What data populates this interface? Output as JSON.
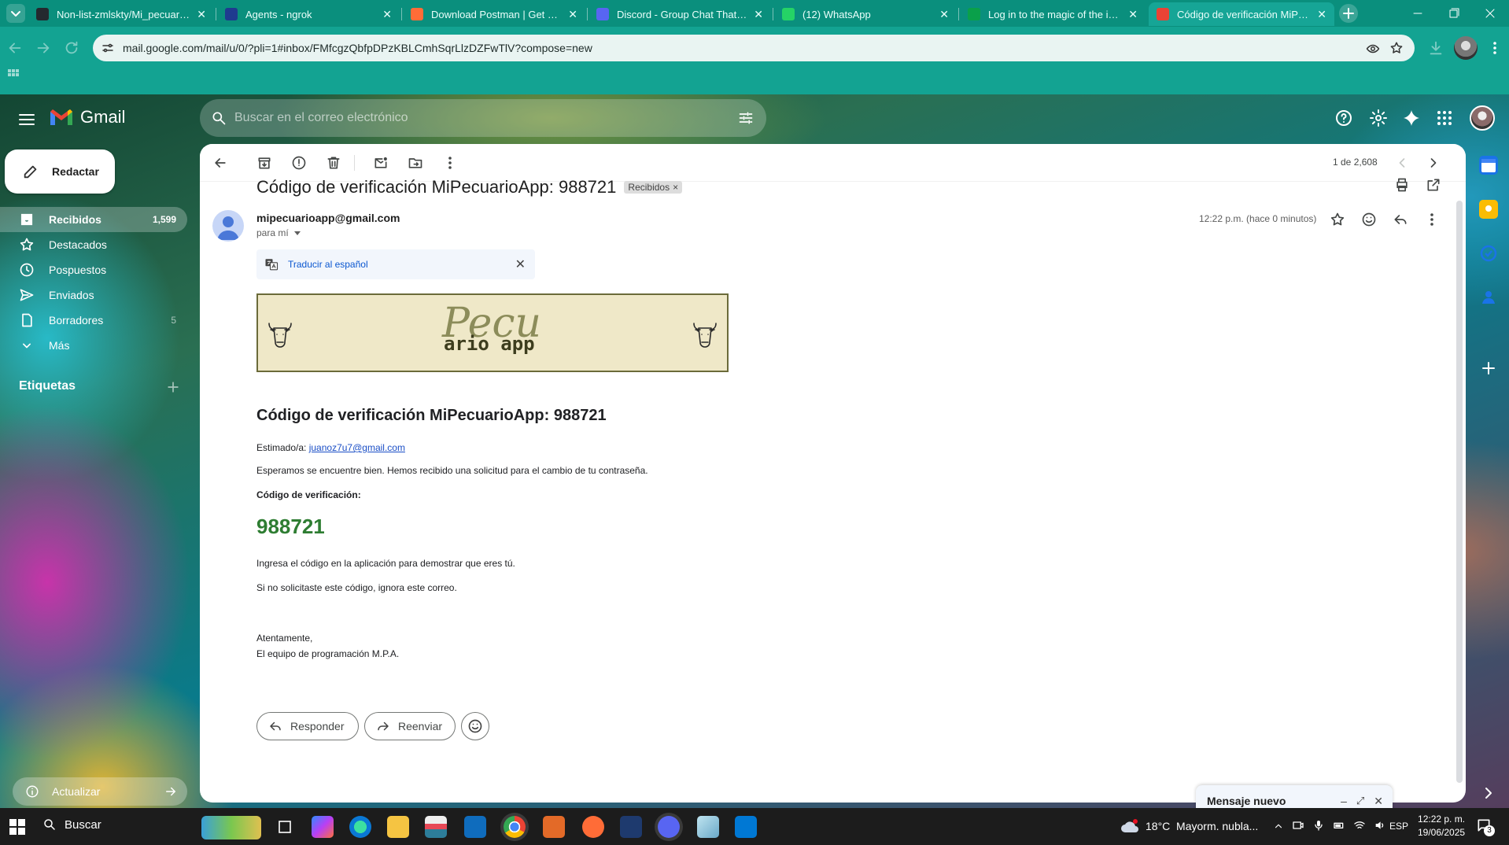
{
  "tabs": [
    {
      "label": "Non-list-zmlskty/Mi_pecuario_a",
      "favicon_color": "#24292f"
    },
    {
      "label": "Agents - ngrok",
      "favicon_color": "#1f3b8f"
    },
    {
      "label": "Download Postman | Get Starte",
      "favicon_color": "#ff6c37"
    },
    {
      "label": "Discord - Group Chat That's All",
      "favicon_color": "#5865f2"
    },
    {
      "label": "(12) WhatsApp",
      "favicon_color": "#25d366"
    },
    {
      "label": "Log in to the magic of the inter",
      "favicon_color": "#0aa04a"
    },
    {
      "label": "Código de verificación MiPecua",
      "favicon_color": "#ea4335"
    }
  ],
  "browser": {
    "url": "mail.google.com/mail/u/0/?pli=1#inbox/FMfcgzQbfpDPzKBLCmhSqrLlzDZFwTlV?compose=new"
  },
  "gmail": {
    "logo_text": "Gmail",
    "search_placeholder": "Buscar en el correo electrónico"
  },
  "sidebar": {
    "compose_label": "Redactar",
    "items": [
      {
        "label": "Recibidos",
        "count": "1,599",
        "icon": "inbox-icon"
      },
      {
        "label": "Destacados",
        "count": "",
        "icon": "star-icon"
      },
      {
        "label": "Pospuestos",
        "count": "",
        "icon": "clock-icon"
      },
      {
        "label": "Enviados",
        "count": "",
        "icon": "send-icon"
      },
      {
        "label": "Borradores",
        "count": "5",
        "icon": "draft-icon"
      },
      {
        "label": "Más",
        "count": "",
        "icon": "chevron-down-icon"
      }
    ],
    "labels_heading": "Etiquetas",
    "update_label": "Actualizar"
  },
  "message_toolbar": {
    "pagination": "1 de 2,608"
  },
  "email": {
    "subject": "Código de verificación MiPecuarioApp: 988721",
    "label_chip": "Recibidos",
    "sender": "mipecuarioapp@gmail.com",
    "to_line": "para mí",
    "time": "12:22 p.m. (hace 0 minutos)",
    "translate_label": "Traducir al español",
    "banner": {
      "logo_line1": "Pecu",
      "logo_line2": "ario app",
      "bg": "#efe8c8",
      "border": "#6b6b3a"
    },
    "heading": "Código de verificación MiPecuarioApp: 988721",
    "greeting_prefix": "Estimado/a: ",
    "greeting_email": "juanoz7u7@gmail.com",
    "intro": "Esperamos se encuentre bien. Hemos recibido una solicitud para el cambio de tu contraseña.",
    "code_label": "Código de verificación:",
    "code": "988721",
    "code_color": "#2e7d32",
    "instructions": "Ingresa el código en la aplicación para demostrar que eres tú.",
    "ignore": "Si no solicitaste este código, ignora este correo.",
    "signoff": "Atentamente,",
    "team": "El equipo de programación M.P.A.",
    "reply_label": "Responder",
    "forward_label": "Reenviar"
  },
  "compose_window": {
    "title": "Mensaje nuevo"
  },
  "taskbar": {
    "search_label": "Buscar",
    "weather": "18°C  Mayorm. nubla...",
    "language": "ESP",
    "time": "12:22 p. m.",
    "date": "19/06/2025",
    "notification_count": "3"
  }
}
